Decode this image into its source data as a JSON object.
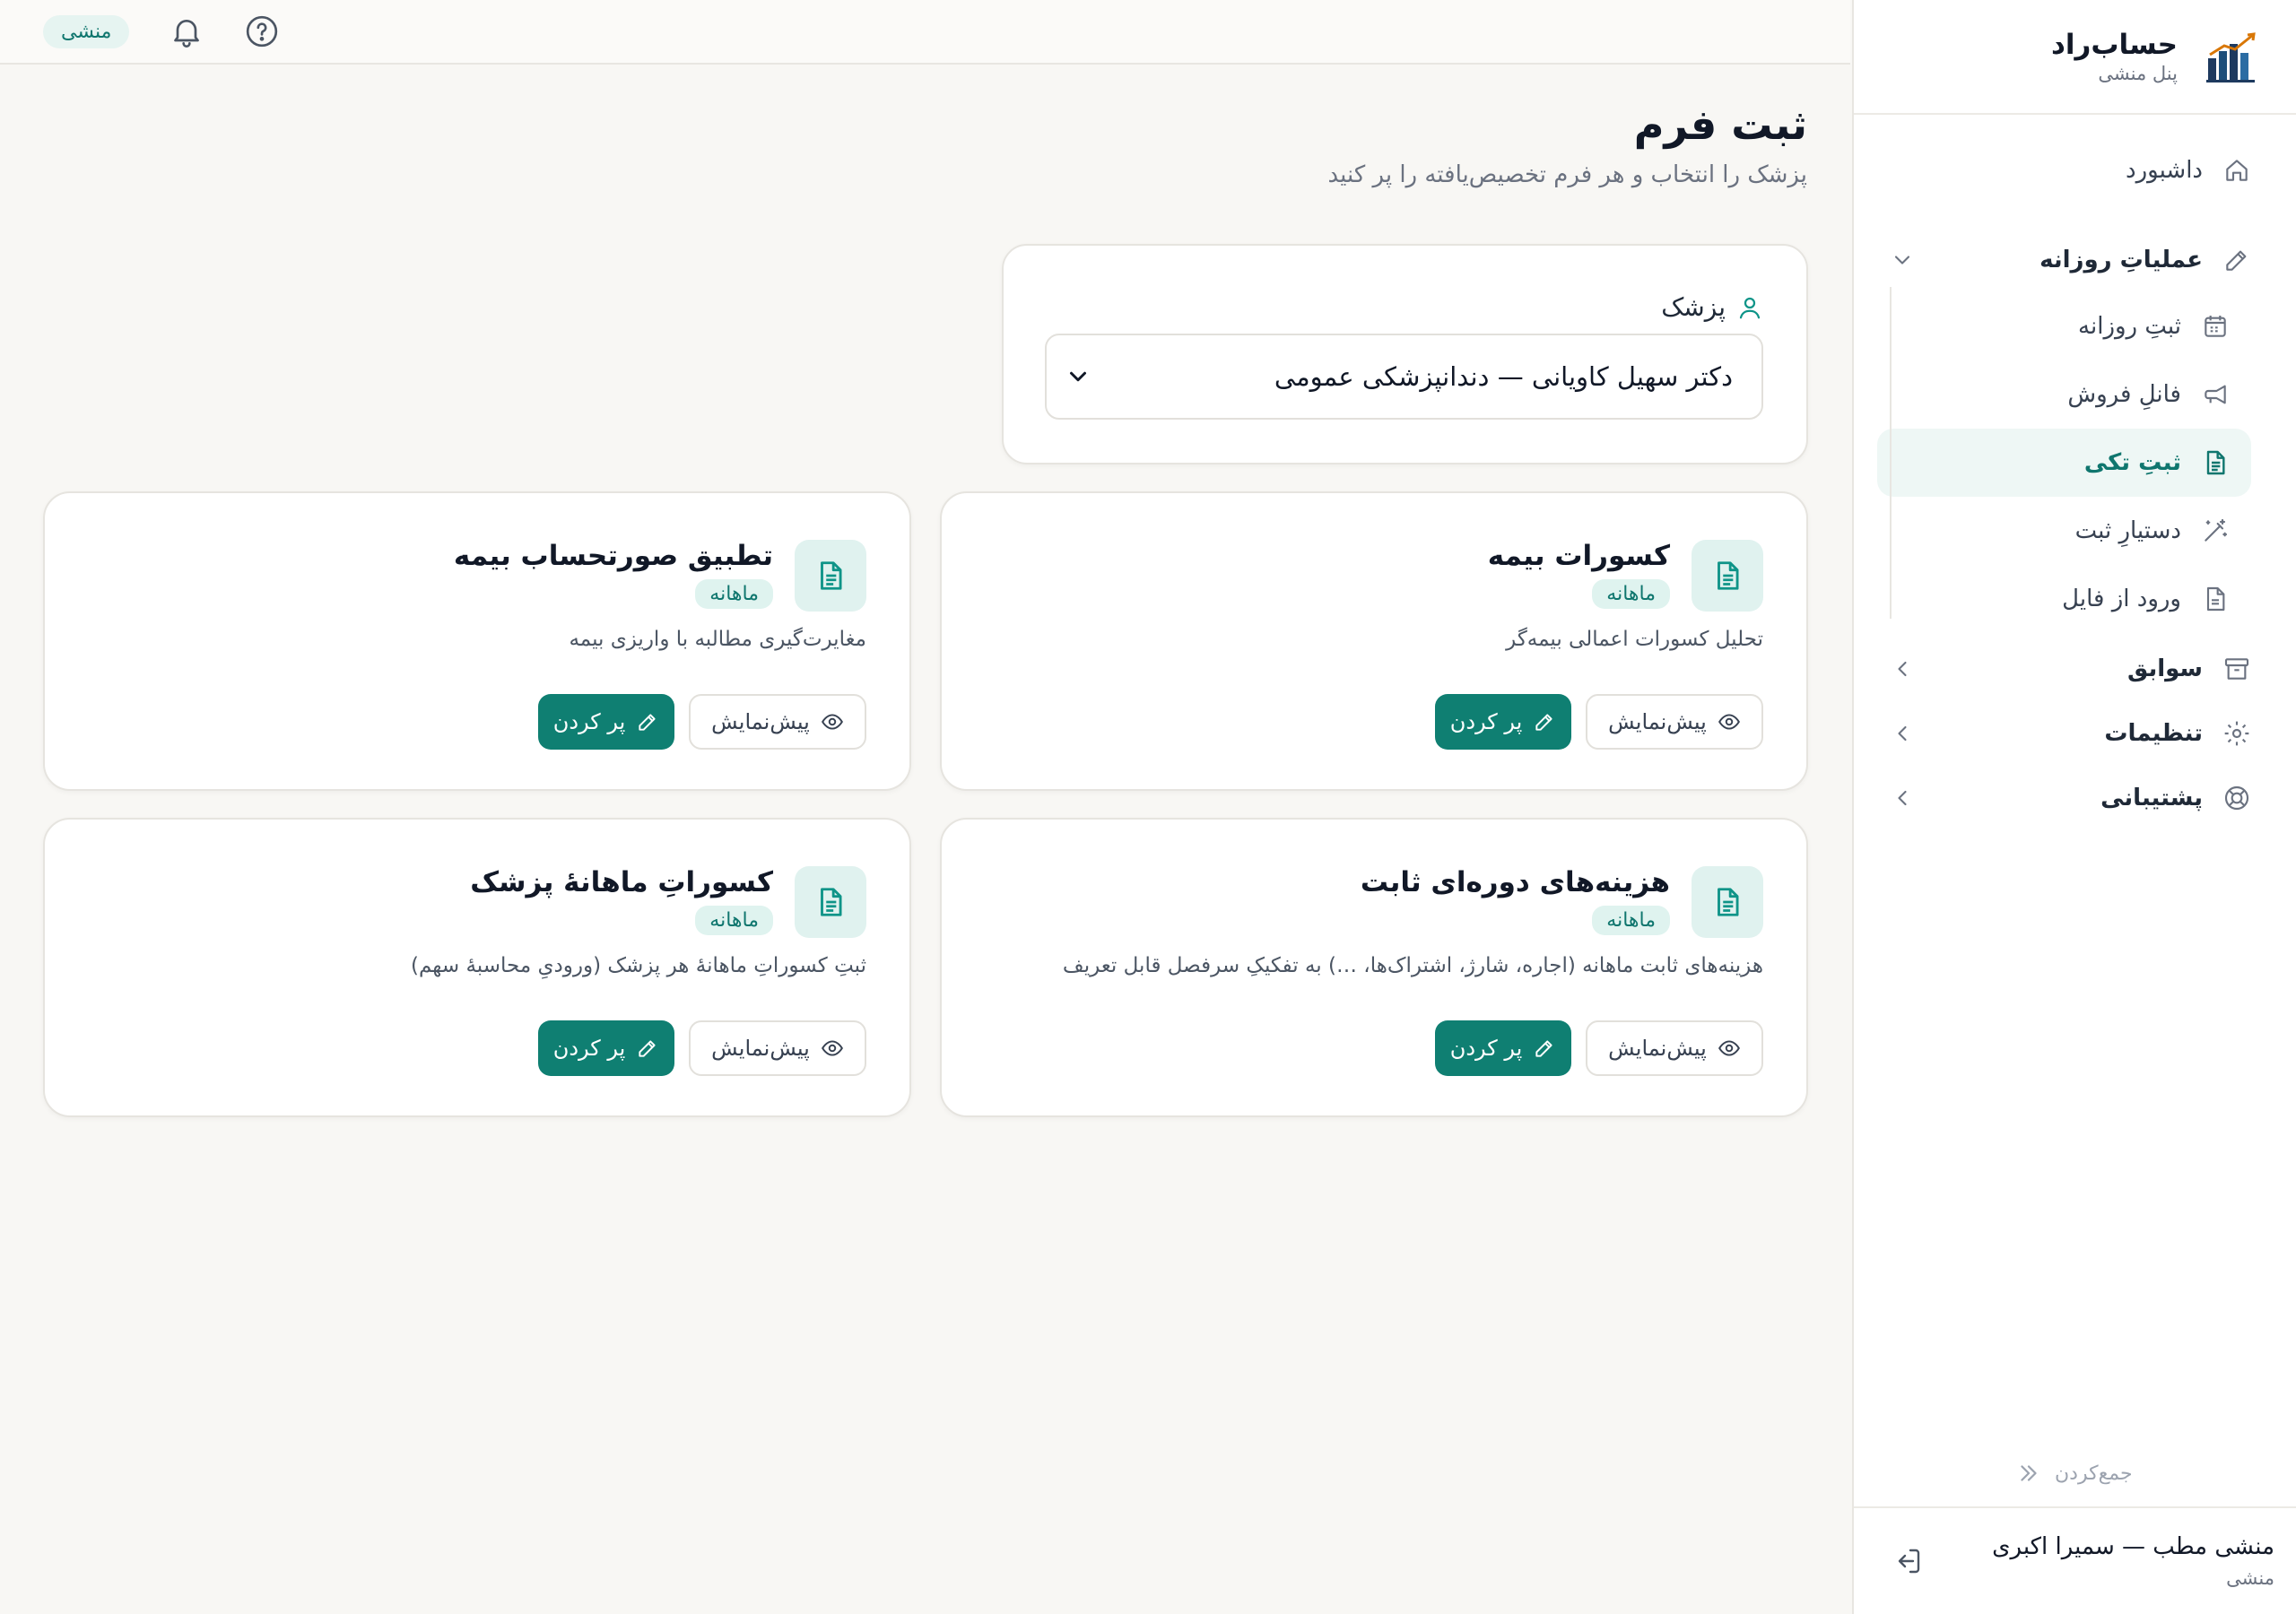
{
  "brand": {
    "title": "حساب‌راد",
    "subtitle": "پنل منشی"
  },
  "topbar": {
    "role_chip": "منشی"
  },
  "sidebar": {
    "dashboard": "داشبورد",
    "daily_ops": "عملیاتِ روزانه",
    "daily_ops_items": [
      "ثبتِ روزانه",
      "فانلِ فروش",
      "ثبتِ تکی",
      "دستیارِ ثبت",
      "ورود از فایل"
    ],
    "history": "سوابق",
    "settings": "تنظیمات",
    "support": "پشتیبانی",
    "collapse": "جمع‌کردن",
    "user_name": "منشی مطب — سمیرا اکبری",
    "user_role": "منشی"
  },
  "page": {
    "title": "ثبت فرم",
    "subtitle": "پزشک را انتخاب و هر فرم تخصیص‌یافته را پر کنید"
  },
  "doctor": {
    "label": "پزشک",
    "selected": "دکتر سهیل کاویانی — دندانپزشکی عمومی"
  },
  "forms": [
    {
      "title": "کسورات بیمه",
      "badge": "ماهانه",
      "desc": "تحلیل کسورات اعمالی بیمه‌گر",
      "preview": "پیش‌نمایش",
      "fill": "پر کردن"
    },
    {
      "title": "تطبیق صورتحساب بیمه",
      "badge": "ماهانه",
      "desc": "مغایرت‌گیری مطالبه با واریزی بیمه",
      "preview": "پیش‌نمایش",
      "fill": "پر کردن"
    },
    {
      "title": "هزینه‌های دوره‌ای ثابت",
      "badge": "ماهانه",
      "desc": "هزینه‌های ثابت ماهانه (اجاره، شارژ، اشتراک‌ها، …) به تفکیکِ سرفصل قابل تعریف",
      "preview": "پیش‌نمایش",
      "fill": "پر کردن"
    },
    {
      "title": "کسوراتِ ماهانهٔ پزشک",
      "badge": "ماهانه",
      "desc": "ثبتِ کسوراتِ ماهانهٔ هر پزشک (ورودیِ محاسبهٔ سهم)",
      "preview": "پیش‌نمایش",
      "fill": "پر کردن"
    }
  ],
  "colors": {
    "accent": "#0f7f72",
    "accent_soft": "#e0f2ef",
    "background": "#f8f7f4"
  }
}
